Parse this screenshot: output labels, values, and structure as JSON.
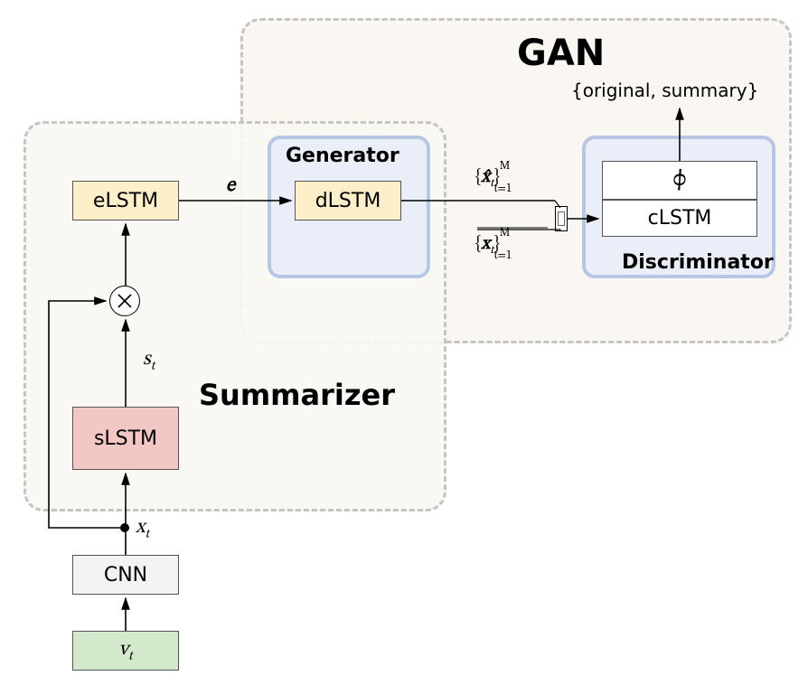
{
  "groups": {
    "summarizer_title": "Summarizer",
    "gan_title": "GAN",
    "generator_title": "Generator",
    "discriminator_title": "Discriminator"
  },
  "blocks": {
    "vt": "v<sub>t</sub>",
    "cnn": "CNN",
    "slstm": "sLSTM",
    "elstm": "eLSTM",
    "dlstm": "dLSTM",
    "clstm": "cLSTM",
    "phi": "ϕ"
  },
  "edge_labels": {
    "xt": "x<sub>t</sub>",
    "st": "s<sub>t</sub>",
    "e": "e",
    "xhat_seq": "{<span class='math'>x̂</span><sub>t</sub>}<span class='mathup'><sub>t=1</sub><sup style='margin-left:-1.35em;'>M</sup></span>",
    "x_seq": "{<span class='math'>x</span><sub>t</sub>}<span class='mathup'><sub>t=1</sub><sup style='margin-left:-1.35em;'>M</sup></span>",
    "disc_out": "{original, summary}"
  }
}
